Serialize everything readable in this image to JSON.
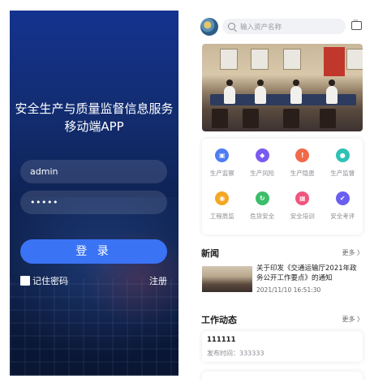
{
  "login": {
    "title_line1": "安全生产与质量监督信息服务",
    "title_line2": "移动端APP",
    "username_value": "admin",
    "password_value": "•••••",
    "login_button": "登 录",
    "remember_label": "记住密码",
    "register_link": "注册",
    "colors": {
      "background": "#14338f",
      "accent": "#3a73f4"
    }
  },
  "home": {
    "search_placeholder": "输入资产名称",
    "grid": [
      {
        "label": "生产监察",
        "icon": "building-icon",
        "color": "#4e7df2",
        "glyph": "▣"
      },
      {
        "label": "生产风险",
        "icon": "shield-icon",
        "color": "#7a5af0",
        "glyph": "◆"
      },
      {
        "label": "生产隐患",
        "icon": "warning-icon",
        "color": "#f06a4a",
        "glyph": "!"
      },
      {
        "label": "生产监督",
        "icon": "location-icon",
        "color": "#2ec2b5",
        "glyph": "●"
      },
      {
        "label": "工程质监",
        "icon": "quality-icon",
        "color": "#f5a623",
        "glyph": "◉"
      },
      {
        "label": "危货安全",
        "icon": "hazmat-icon",
        "color": "#3bbd6a",
        "glyph": "↻"
      },
      {
        "label": "安全培训",
        "icon": "training-icon",
        "color": "#f0557e",
        "glyph": "▦"
      },
      {
        "label": "安全考评",
        "icon": "evaluation-icon",
        "color": "#6a5ff0",
        "glyph": "✔"
      }
    ],
    "news": {
      "title": "新闻",
      "more": "更多 〉",
      "item_title": "关于印发《交通运输厅2021年政务公开工作要点》的通知",
      "item_time": "2021/11/10 16:51:30"
    },
    "work": {
      "title": "工作动态",
      "more": "更多 〉",
      "item_title": "111111",
      "item_time": "发布时间：333333"
    }
  }
}
